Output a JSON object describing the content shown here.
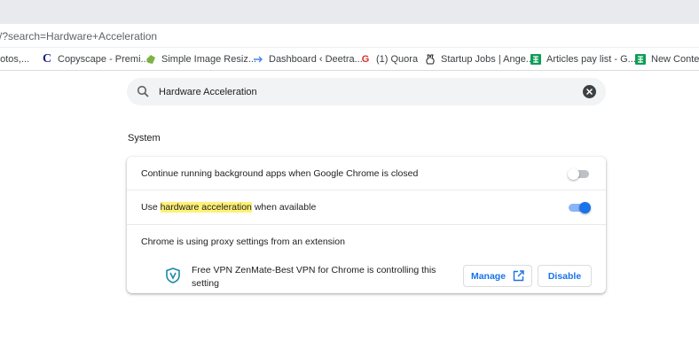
{
  "address_bar": {
    "url": "/?search=Hardware+Acceleration"
  },
  "bookmarks": [
    {
      "label": "hotos,...",
      "icon": "none"
    },
    {
      "label": "Copyscape - Premi...",
      "icon": "copyscape-icon"
    },
    {
      "label": "Simple Image Resiz...",
      "icon": "image-resizer-icon"
    },
    {
      "label": "Dashboard ‹ Deetra...",
      "icon": "arrow-icon"
    },
    {
      "label": "(1) Quora",
      "icon": "quora-icon"
    },
    {
      "label": "Startup Jobs | Ange...",
      "icon": "angellist-icon"
    },
    {
      "label": "Articles pay list - G...",
      "icon": "sheets-icon"
    },
    {
      "label": "New Content",
      "icon": "sheets-icon"
    }
  ],
  "search": {
    "value": "Hardware Acceleration"
  },
  "section": {
    "title": "System"
  },
  "settings": {
    "background_apps": {
      "label": "Continue running background apps when Google Chrome is closed",
      "enabled": false
    },
    "hardware_accel": {
      "label_prefix": "Use ",
      "label_highlight": "hardware acceleration",
      "label_suffix": " when available",
      "enabled": true
    },
    "proxy": {
      "label": "Chrome is using proxy settings from an extension",
      "extension_text": "Free VPN ZenMate-Best VPN for Chrome is controlling this setting",
      "manage_label": "Manage",
      "disable_label": "Disable"
    }
  },
  "colors": {
    "accent": "#1a73e8",
    "highlight": "#fff176",
    "toggle_on_track": "#8ab4f8",
    "toggle_off_track": "#bdc1c6",
    "sheets_green": "#0f9d58"
  }
}
